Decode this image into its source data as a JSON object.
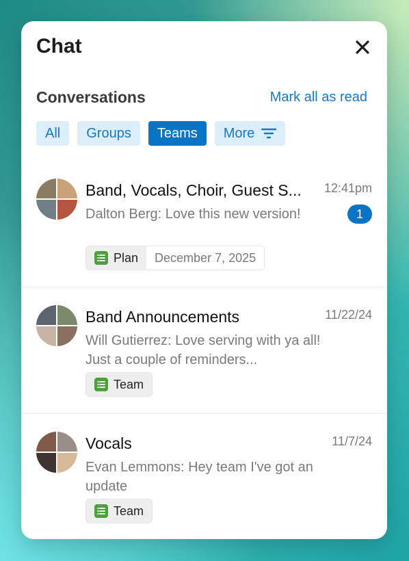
{
  "header": {
    "title": "Chat"
  },
  "section": {
    "title": "Conversations",
    "mark_all_label": "Mark all as read"
  },
  "filters": [
    {
      "label": "All",
      "active": false
    },
    {
      "label": "Groups",
      "active": false
    },
    {
      "label": "Teams",
      "active": true
    },
    {
      "label": "More",
      "active": false,
      "icon": "filter-icon"
    }
  ],
  "conversations": [
    {
      "name": "Band, Vocals, Choir, Guest S...",
      "time": "12:41pm",
      "unread": "1",
      "preview": "Dalton Berg: Love this new version!",
      "tag": "Plan",
      "tag_date": "December 7, 2025",
      "avatar_colors": [
        "#8b7b62",
        "#c9a27a",
        "#6f7f84",
        "#b4563f"
      ]
    },
    {
      "name": "Band Announcements",
      "time": "11/22/24",
      "preview": "Will Gutierrez: Love serving with ya all! Just a couple of reminders...",
      "tag": "Team",
      "avatar_colors": [
        "#5c6470",
        "#7a8a6a",
        "#c9b3a4",
        "#8a6f60"
      ]
    },
    {
      "name": "Vocals",
      "time": "11/7/24",
      "preview": "Evan Lemmons: Hey team I've got an update",
      "tag": "Team",
      "avatar_colors": [
        "#7d5b48",
        "#9a8f88",
        "#3f3530",
        "#d8b99a"
      ]
    }
  ],
  "colors": {
    "accent": "#0a74c4",
    "tag_icon": "#4e9f3d"
  }
}
